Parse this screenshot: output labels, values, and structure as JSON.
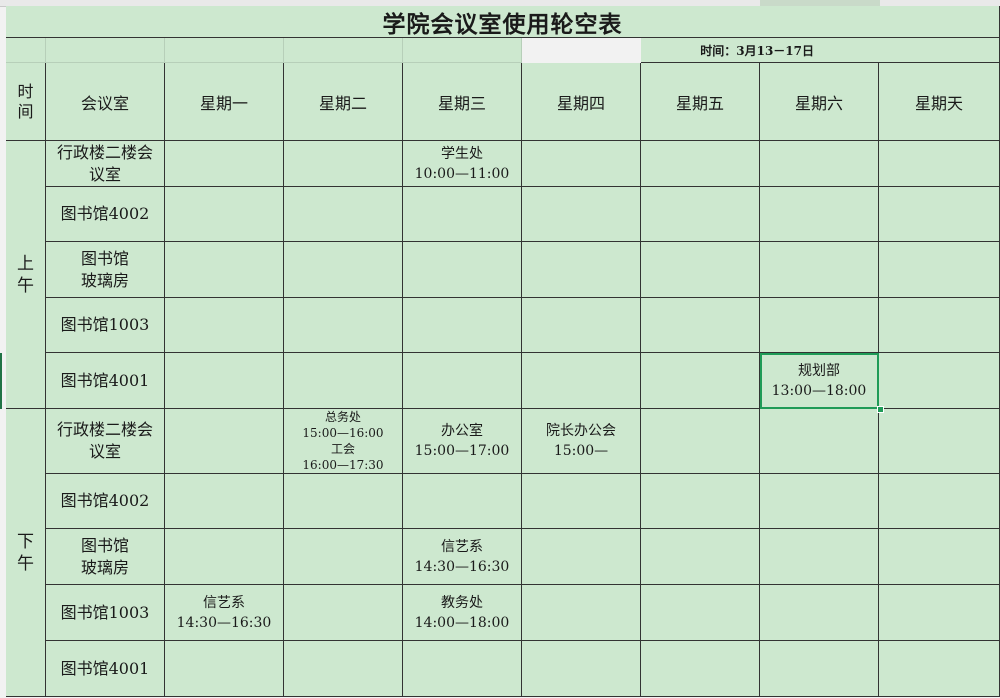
{
  "sheet": {
    "title": "学院会议室使用轮空表",
    "date_range": "时间：3月13－17日",
    "header": {
      "time": "时间",
      "room": "会议室",
      "days": [
        "星期一",
        "星期二",
        "星期三",
        "星期四",
        "星期五",
        "星期六",
        "星期天"
      ]
    },
    "periods": [
      "上午",
      "下午"
    ],
    "rooms": [
      [
        "行政楼二楼会",
        "议室"
      ],
      [
        "图书馆4002"
      ],
      [
        "图书馆",
        "玻璃房"
      ],
      [
        "图书馆1003"
      ],
      [
        "图书馆4001"
      ]
    ],
    "morning": [
      [
        "",
        "",
        [
          "学生处",
          "10:00—11:00"
        ],
        "",
        "",
        "",
        ""
      ],
      [
        "",
        "",
        "",
        "",
        "",
        "",
        ""
      ],
      [
        "",
        "",
        "",
        "",
        "",
        "",
        ""
      ],
      [
        "",
        "",
        "",
        "",
        "",
        "",
        ""
      ],
      [
        "",
        "",
        "",
        "",
        "",
        [
          "规划部",
          "13:00—18:00"
        ],
        ""
      ]
    ],
    "afternoon": [
      [
        "",
        [
          "总务处",
          "15:00—16:00",
          "工会",
          "16:00—17:30"
        ],
        [
          "办公室",
          "15:00—17:00"
        ],
        [
          "院长办公会",
          "15:00—"
        ],
        "",
        "",
        ""
      ],
      [
        "",
        "",
        "",
        "",
        "",
        "",
        ""
      ],
      [
        "",
        "",
        [
          "信艺系",
          "14:30—16:30"
        ],
        "",
        "",
        "",
        ""
      ],
      [
        [
          "信艺系",
          "14:30—16:30"
        ],
        "",
        [
          "教务处",
          "14:00—18:00"
        ],
        "",
        "",
        "",
        ""
      ],
      [
        "",
        "",
        "",
        "",
        "",
        "",
        ""
      ]
    ],
    "selected_cell": "规划部 13:00—18:00"
  }
}
